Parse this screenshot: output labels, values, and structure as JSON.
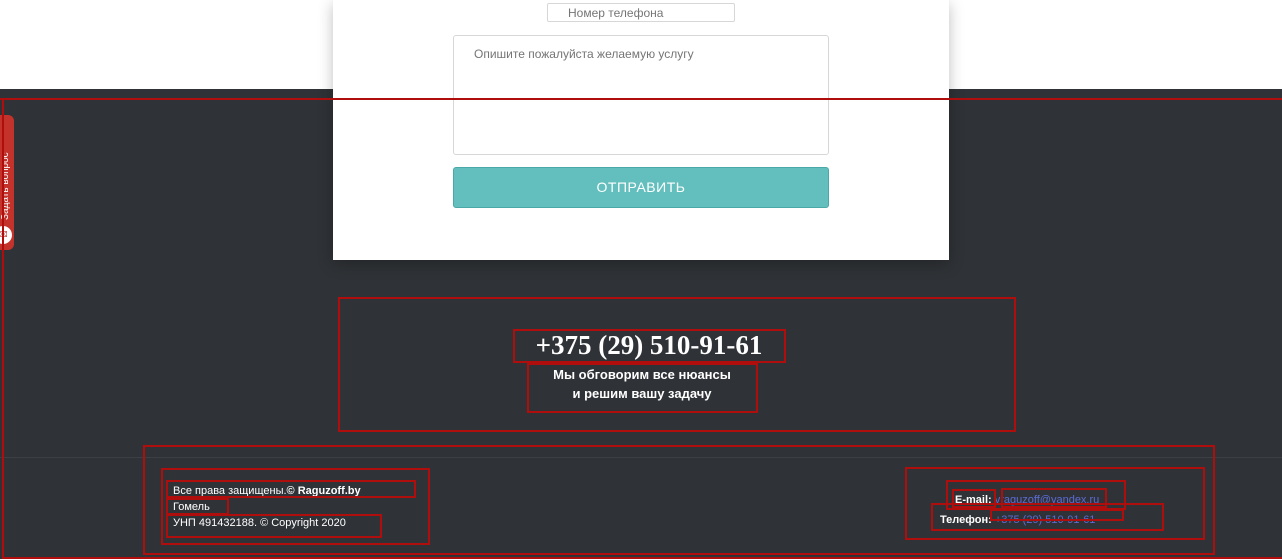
{
  "form": {
    "phone_placeholder": "Номер телефона",
    "message_placeholder": "Опишите пожалуйста желаемую услугу",
    "submit_label": "ОТПРАВИТЬ"
  },
  "side_tab": {
    "label": "Задать вопрос",
    "icon": "chat-icon"
  },
  "contact_block": {
    "phone": "+375 (29) 510-91-61",
    "tagline_line1": "Мы обговорим все нюансы",
    "tagline_line2": "и решим вашу задачу"
  },
  "footer": {
    "rights_prefix": "Все права защищены.",
    "rights_brand": "© Raguzoff.by",
    "city": "Гомель",
    "unp": "УНП 491432188. © Copyright 2020",
    "email_label": "E-mail:",
    "email_value": "vraguzoff@yandex.ru",
    "phone_label": "Телефон:",
    "phone_value": "+375 (29) 510-91-61"
  },
  "colors": {
    "accent_button": "#63bfbd",
    "footer_bg": "#2f3236",
    "tab_red": "#c4322c",
    "outline_red": "#b00d0d",
    "link": "#5b6cd6"
  }
}
